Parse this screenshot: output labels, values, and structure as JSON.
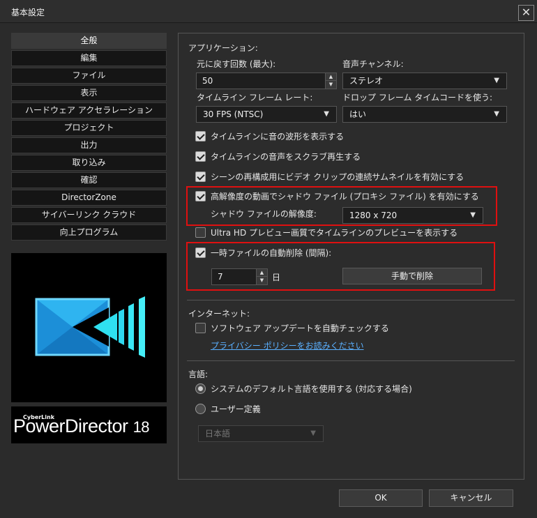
{
  "window": {
    "title": "基本設定",
    "close_symbol": "✕"
  },
  "sidebar": {
    "items": [
      {
        "label": "全般",
        "active": true
      },
      {
        "label": "編集"
      },
      {
        "label": "ファイル"
      },
      {
        "label": "表示"
      },
      {
        "label": "ハードウェア アクセラレーション"
      },
      {
        "label": "プロジェクト"
      },
      {
        "label": "出力"
      },
      {
        "label": "取り込み"
      },
      {
        "label": "確認"
      },
      {
        "label": "DirectorZone"
      },
      {
        "label": "サイバーリンク クラウド"
      },
      {
        "label": "向上プログラム"
      }
    ]
  },
  "brand": {
    "small": "CyberLink",
    "name": "PowerDirector",
    "version": "18",
    "logo_icon": "powerdirector-logo-icon",
    "colors": {
      "blue": "#1fa3e8",
      "cyan": "#2fe0f0"
    }
  },
  "application": {
    "section_title": "アプリケーション:",
    "undo_label": "元に戻す回数 (最大):",
    "undo_value": "50",
    "audio_channel_label": "音声チャンネル:",
    "audio_channel_value": "ステレオ",
    "timeline_fps_label": "タイムライン フレーム レート:",
    "timeline_fps_value": "30 FPS (NTSC)",
    "dropframe_label": "ドロップ フレーム タイムコードを使う:",
    "dropframe_value": "はい",
    "checks": {
      "waveform": {
        "label": "タイムラインに音の波形を表示する",
        "checked": true
      },
      "scrub": {
        "label": "タイムラインの音声をスクラブ再生する",
        "checked": true
      },
      "thumbnails": {
        "label": "シーンの再構成用にビデオ クリップの連続サムネイルを有効にする",
        "checked": true
      },
      "shadow": {
        "label": "高解像度の動画でシャドウ ファイル (プロキシ ファイル) を有効にする",
        "checked": true
      },
      "uhd_preview": {
        "label": "Ultra HD プレビュー画質でタイムラインのプレビューを表示する",
        "checked": false
      },
      "auto_delete": {
        "label": "一時ファイルの自動削除 (間隔):",
        "checked": true
      }
    },
    "shadow_resolution_label": "シャドウ ファイルの解像度:",
    "shadow_resolution_value": "1280 x 720",
    "auto_delete_value": "7",
    "auto_delete_unit": "日",
    "manual_delete_button": "手動で削除"
  },
  "internet": {
    "section_title": "インターネット:",
    "auto_update_label": "ソフトウェア アップデートを自動チェックする",
    "privacy_link": "プライバシー ポリシーをお読みください"
  },
  "language": {
    "section_title": "言語:",
    "system_default_label": "システムのデフォルト言語を使用する (対応する場合)",
    "user_defined_label": "ユーザー定義",
    "language_value": "日本語"
  },
  "footer": {
    "ok": "OK",
    "cancel": "キャンセル"
  },
  "colors": {
    "highlight": "#e01010",
    "link": "#5ab0ff"
  }
}
